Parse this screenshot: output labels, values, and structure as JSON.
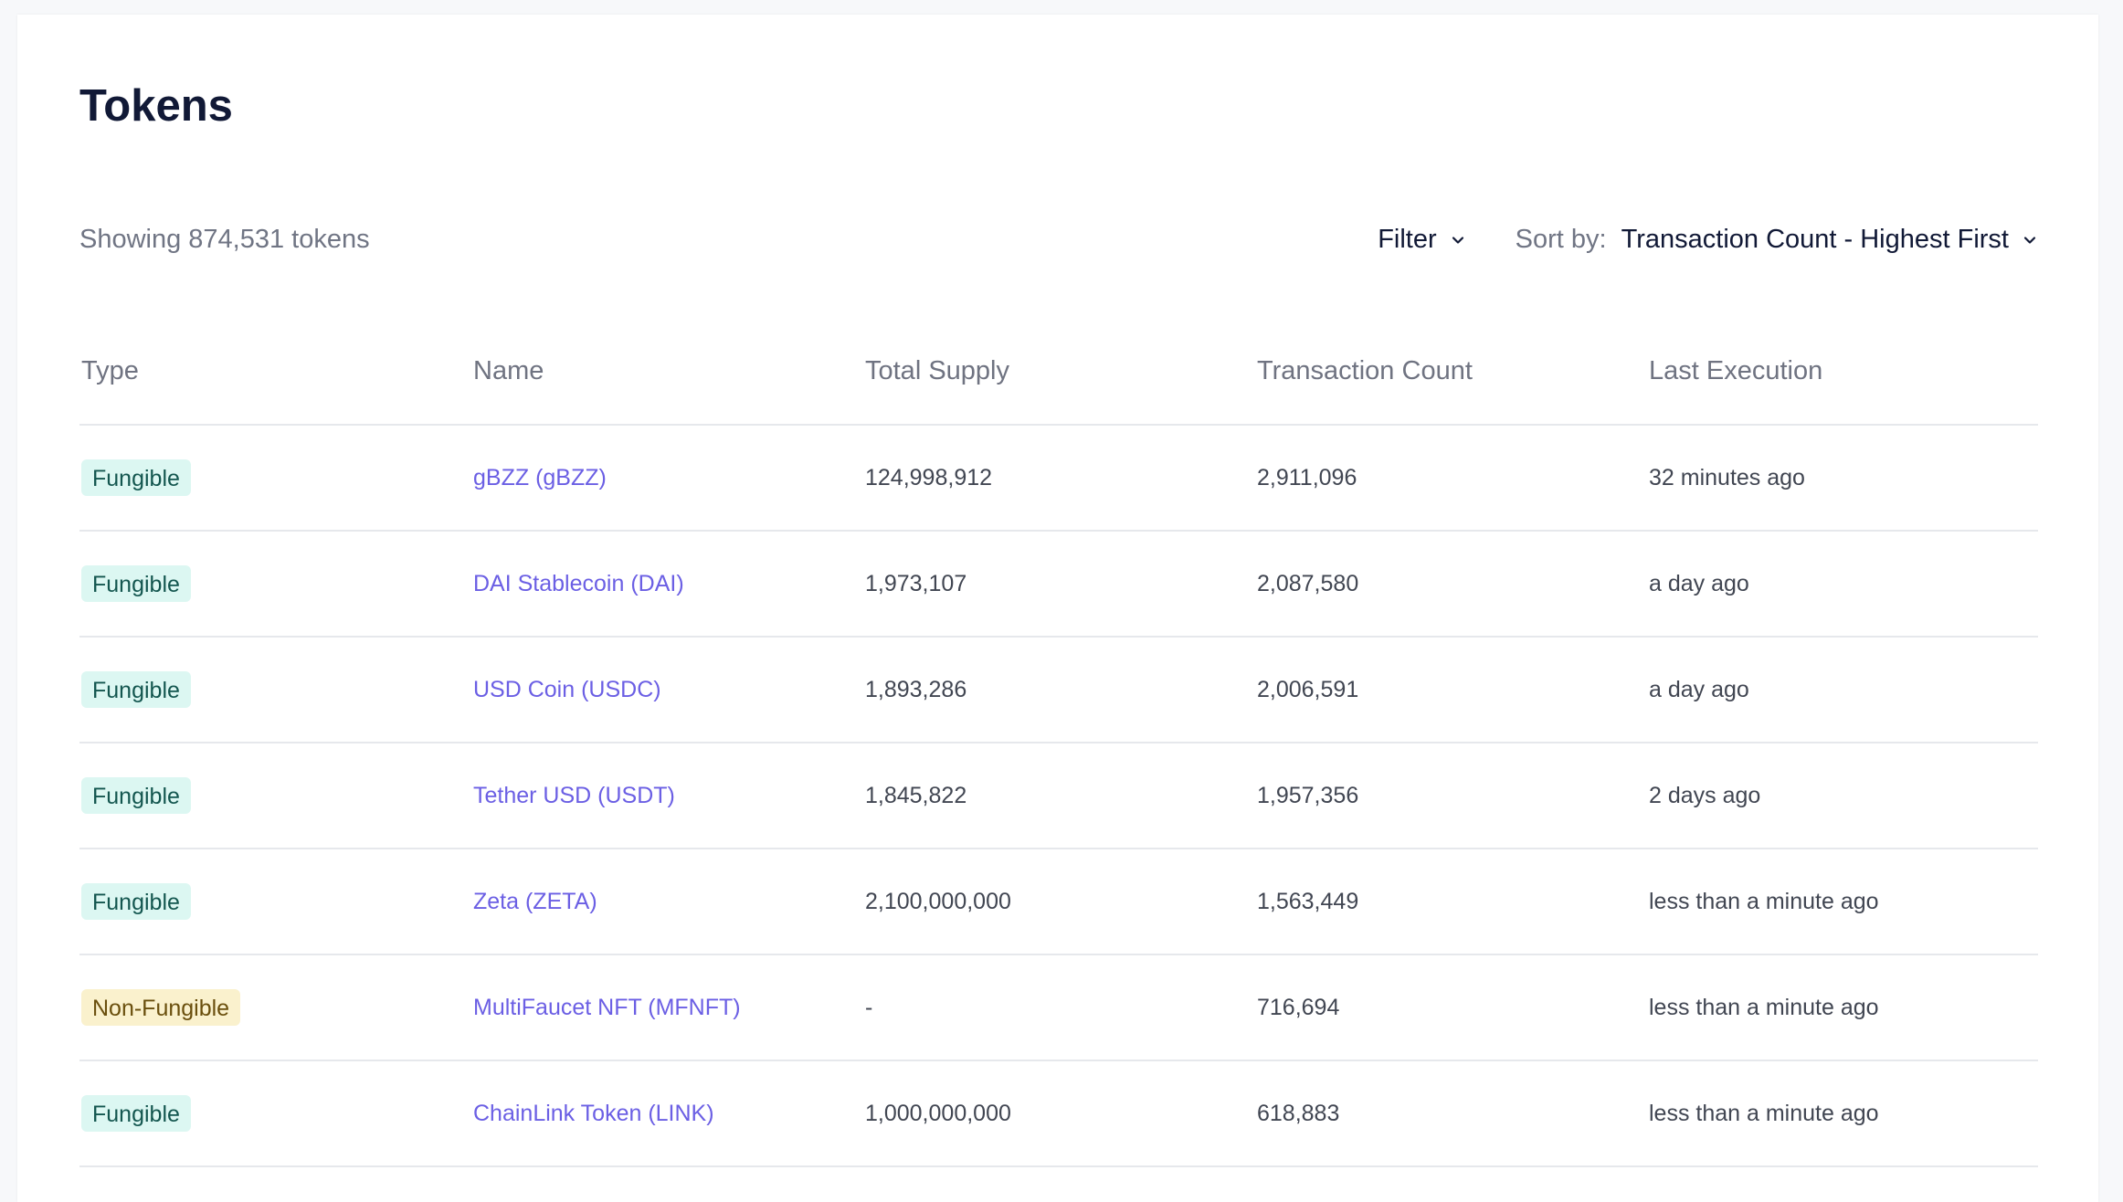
{
  "page": {
    "title": "Tokens"
  },
  "toolbar": {
    "showing_text": "Showing 874,531 tokens",
    "filter_label": "Filter",
    "sort_label": "Sort by:",
    "sort_value": "Transaction Count - Highest First",
    "icons": {
      "filter": "chevron-down-icon",
      "sort": "chevron-down-icon"
    }
  },
  "table": {
    "columns": [
      "Type",
      "Name",
      "Total Supply",
      "Transaction Count",
      "Last Execution"
    ],
    "rows": [
      {
        "type": "Fungible",
        "name": "gBZZ (gBZZ)",
        "total_supply": "124,998,912",
        "transaction_count": "2,911,096",
        "last_execution": "32 minutes ago"
      },
      {
        "type": "Fungible",
        "name": "DAI Stablecoin (DAI)",
        "total_supply": "1,973,107",
        "transaction_count": "2,087,580",
        "last_execution": "a day ago"
      },
      {
        "type": "Fungible",
        "name": "USD Coin (USDC)",
        "total_supply": "1,893,286",
        "transaction_count": "2,006,591",
        "last_execution": "a day ago"
      },
      {
        "type": "Fungible",
        "name": "Tether USD (USDT)",
        "total_supply": "1,845,822",
        "transaction_count": "1,957,356",
        "last_execution": "2 days ago"
      },
      {
        "type": "Fungible",
        "name": "Zeta (ZETA)",
        "total_supply": "2,100,000,000",
        "transaction_count": "1,563,449",
        "last_execution": "less than a minute ago"
      },
      {
        "type": "Non-Fungible",
        "name": "MultiFaucet NFT (MFNFT)",
        "total_supply": "-",
        "transaction_count": "716,694",
        "last_execution": "less than a minute ago"
      },
      {
        "type": "Fungible",
        "name": "ChainLink Token (LINK)",
        "total_supply": "1,000,000,000",
        "transaction_count": "618,883",
        "last_execution": "less than a minute ago"
      }
    ]
  },
  "colors": {
    "background": "#f7f8fa",
    "title": "#111936",
    "muted_text": "#707584",
    "link": "#6b5fe4",
    "fungible_badge_bg": "#dcf7f2",
    "fungible_badge_text": "#13564f",
    "nonfungible_badge_bg": "#faf1cd",
    "nonfungible_badge_text": "#6a4f0d"
  }
}
